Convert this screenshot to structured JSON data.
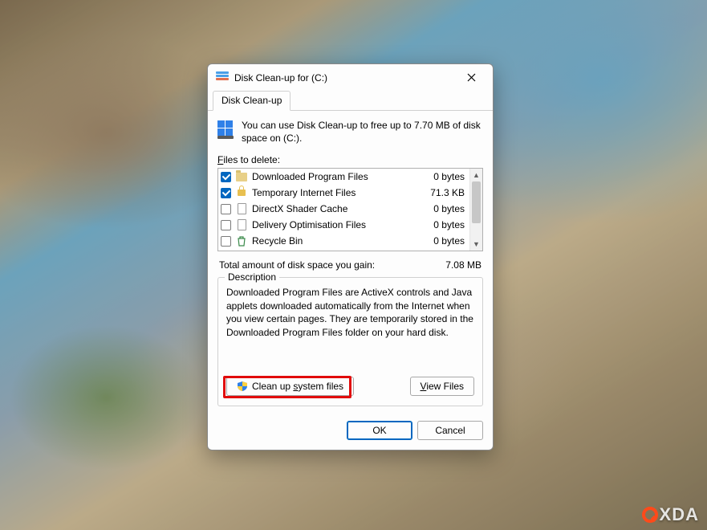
{
  "window": {
    "title": "Disk Clean-up for  (C:)"
  },
  "tab": {
    "label": "Disk Clean-up"
  },
  "info": {
    "text": "You can use Disk Clean-up to free up to 7.70 MB of disk space on  (C:)."
  },
  "files_label_full": "Files to delete:",
  "files": [
    {
      "checked": true,
      "icon": "folder",
      "name": "Downloaded Program Files",
      "size": "0 bytes"
    },
    {
      "checked": true,
      "icon": "lock",
      "name": "Temporary Internet Files",
      "size": "71.3 KB"
    },
    {
      "checked": false,
      "icon": "page",
      "name": "DirectX Shader Cache",
      "size": "0 bytes"
    },
    {
      "checked": false,
      "icon": "page",
      "name": "Delivery Optimisation Files",
      "size": "0 bytes"
    },
    {
      "checked": false,
      "icon": "recycle",
      "name": "Recycle Bin",
      "size": "0 bytes"
    }
  ],
  "total": {
    "label": "Total amount of disk space you gain:",
    "value": "7.08 MB"
  },
  "description": {
    "title": "Description",
    "text": "Downloaded Program Files are ActiveX controls and Java applets downloaded automatically from the Internet when you view certain pages. They are temporarily stored in the Downloaded Program Files folder on your hard disk."
  },
  "buttons": {
    "system_pre": "Clean up ",
    "system_u": "s",
    "system_post": "ystem files",
    "view_pre": "",
    "view_u": "V",
    "view_post": "iew Files",
    "ok": "OK",
    "cancel": "Cancel"
  },
  "watermark": {
    "text": "XDA"
  }
}
